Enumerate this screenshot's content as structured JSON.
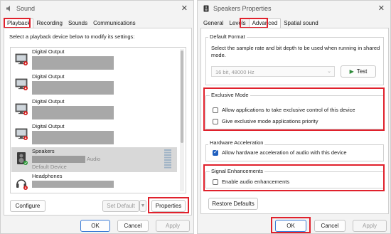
{
  "sound": {
    "title": "Sound",
    "close": "✕",
    "tabs": [
      {
        "label": "Playback"
      },
      {
        "label": "Recording"
      },
      {
        "label": "Sounds"
      },
      {
        "label": "Communications"
      }
    ],
    "instruction": "Select a playback device below to modify its settings:",
    "devices": [
      {
        "name": "Digital Output",
        "line2": "",
        "line3": ""
      },
      {
        "name": "Digital Output",
        "line2": "",
        "line3": ""
      },
      {
        "name": "Digital Output",
        "line2": "",
        "line3": ""
      },
      {
        "name": "Digital Output",
        "line2": "",
        "line3": ""
      },
      {
        "name": "Speakers",
        "line2": "Audio",
        "line3": "Default Device"
      },
      {
        "name": "Headphones",
        "line2": "",
        "line3": ""
      }
    ],
    "configure": "Configure",
    "set_default": "Set Default",
    "properties": "Properties",
    "ok": "OK",
    "cancel": "Cancel",
    "apply": "Apply"
  },
  "props": {
    "title": "Speakers Properties",
    "close": "✕",
    "tabs": [
      {
        "label": "General"
      },
      {
        "label": "Levels"
      },
      {
        "label": "Advanced"
      },
      {
        "label": "Spatial sound"
      }
    ],
    "default_format": {
      "title": "Default Format",
      "desc": "Select the sample rate and bit depth to be used when running in shared mode.",
      "select_value": "16 bit, 48000 Hz",
      "test": "Test"
    },
    "exclusive": {
      "title": "Exclusive Mode",
      "opt1": "Allow applications to take exclusive control of this device",
      "opt2": "Give exclusive mode applications priority"
    },
    "hw": {
      "title": "Hardware Acceleration",
      "opt1": "Allow hardware acceleration of audio with this device"
    },
    "signal": {
      "title": "Signal Enhancements",
      "opt1": "Enable audio enhancements"
    },
    "restore": "Restore Defaults",
    "ok": "OK",
    "cancel": "Cancel",
    "apply": "Apply"
  },
  "colors": {
    "highlight": "#e0212c",
    "accent": "#1f5fbf",
    "test_play": "#2e8b3a"
  }
}
